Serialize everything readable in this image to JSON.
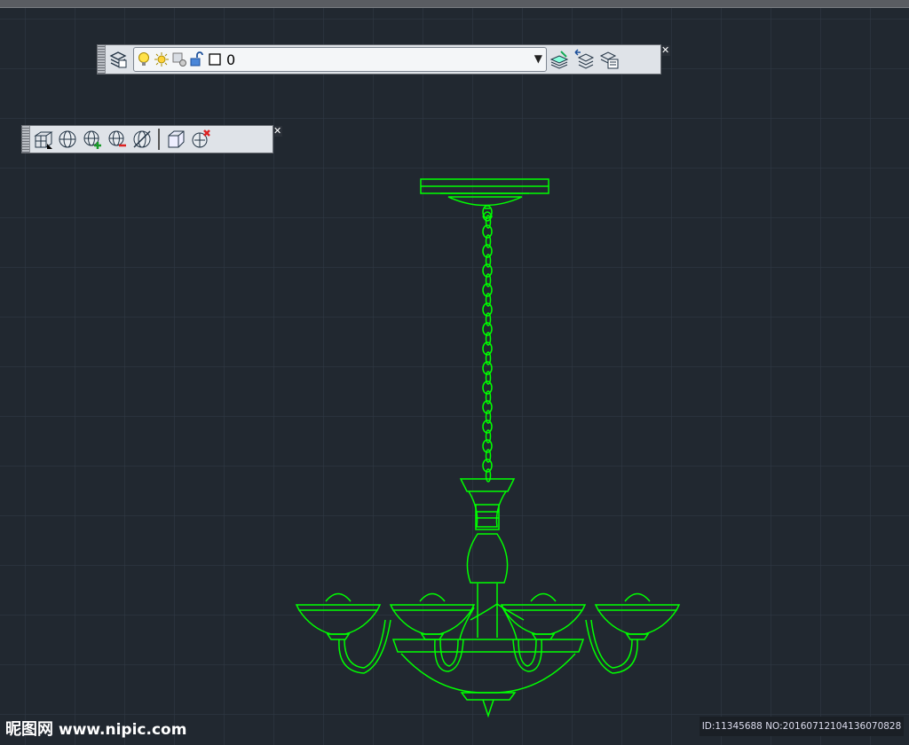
{
  "layer_toolbar": {
    "current_layer": "0",
    "icons": [
      "layer-properties-icon",
      "lightbulb-icon",
      "sun-icon",
      "freeze-viewport-icon",
      "unlock-icon",
      "color-swatch-icon",
      "layer-state-icon",
      "previous-layer-icon",
      "layer-manager-icon"
    ]
  },
  "view_toolbar": {
    "icons": [
      "viewport-grid-icon",
      "globe-icon",
      "globe-add-icon",
      "globe-remove-icon",
      "globe-delete-icon",
      "cube-icon",
      "cube-remove-icon"
    ]
  },
  "colors": {
    "background": "#212830",
    "grid": "#2f3844",
    "drawing": "#00ff00"
  },
  "watermark": {
    "brand": "昵图网",
    "url": "www.nipic.com"
  },
  "image_id": "ID:11345688 NO:20160712104136070828"
}
